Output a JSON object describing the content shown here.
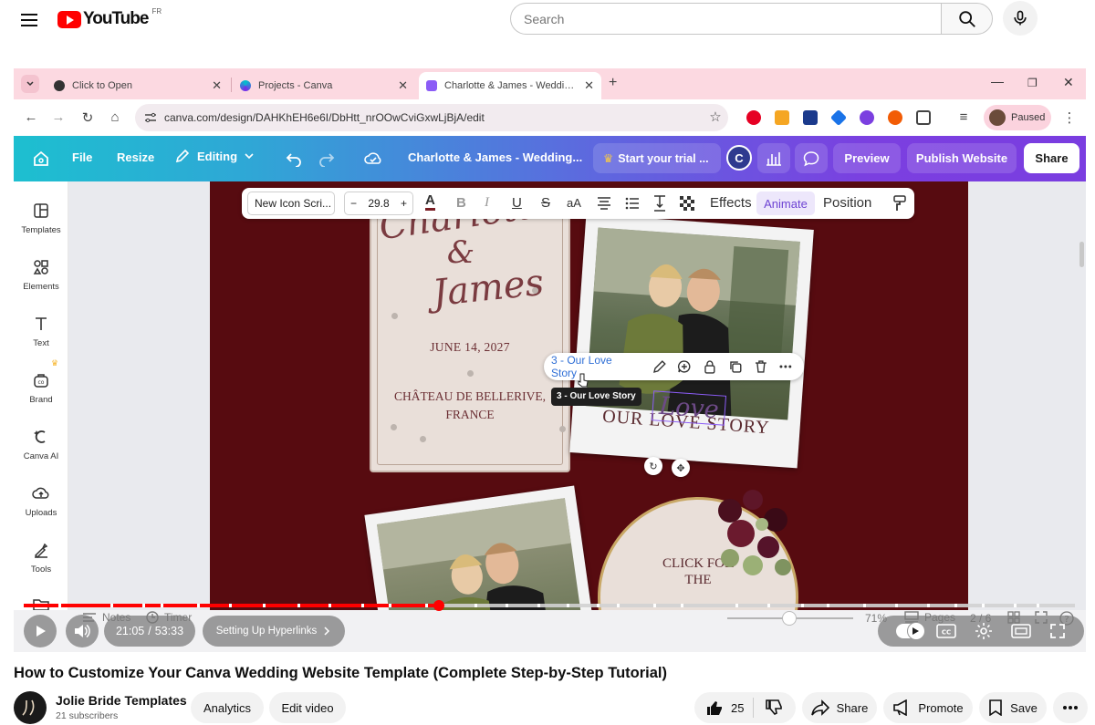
{
  "youtube": {
    "logo_text": "YouTube",
    "country": "FR",
    "search_placeholder": "Search"
  },
  "browser": {
    "tabs": [
      {
        "label": "Click to Open",
        "active": false
      },
      {
        "label": "Projects - Canva",
        "active": false
      },
      {
        "label": "Charlotte & James - Wedding W",
        "active": true
      }
    ],
    "url": "canva.com/design/DAHKhEH6e6I/DbHtt_nrOOwCviGxwLjBjA/edit",
    "profile_label": "Paused"
  },
  "canva": {
    "toolbar": {
      "file": "File",
      "resize": "Resize",
      "editing": "Editing",
      "doc_title": "Charlotte & James - Wedding...",
      "trial": "Start your trial ...",
      "avatar_initial": "C",
      "preview": "Preview",
      "publish": "Publish Website",
      "share": "Share"
    },
    "rail": [
      {
        "label": "Templates",
        "icon": "templates-icon"
      },
      {
        "label": "Elements",
        "icon": "elements-icon"
      },
      {
        "label": "Text",
        "icon": "text-icon"
      },
      {
        "label": "Brand",
        "icon": "brand-icon"
      },
      {
        "label": "Canva AI",
        "icon": "canva-ai-icon"
      },
      {
        "label": "Uploads",
        "icon": "uploads-icon"
      },
      {
        "label": "Tools",
        "icon": "tools-icon"
      }
    ],
    "format_bar": {
      "font": "New Icon Scri...",
      "size": "29.8",
      "case": "aA",
      "effects": "Effects",
      "animate": "Animate",
      "position": "Position"
    },
    "canvas": {
      "card_script": [
        "Charlotte",
        "&",
        "James"
      ],
      "card_date": "JUNE 14, 2027",
      "card_venue_line1": "CHÂTEAU DE BELLERIVE,",
      "card_venue_line2": "FRANCE",
      "photo_caption": "OUR LOVE STORY",
      "photo_caption_script": "Love",
      "circle_line1": "CLICK FOR",
      "circle_line2": "THE"
    },
    "link_popup": {
      "label": "3 - Our Love Story",
      "tooltip": "3 - Our Love Story"
    },
    "bottom": {
      "notes": "Notes",
      "timer": "Timer",
      "zoom": "71%",
      "pages": "Pages",
      "page_counter": "2 / 6"
    }
  },
  "player": {
    "current_time": "21:05",
    "duration": "53:33",
    "chapter": "Setting Up Hyperlinks",
    "progress_fraction": 0.395
  },
  "video_meta": {
    "title": "How to Customize Your Canva Wedding Website Template (Complete Step-by-Step Tutorial)",
    "channel": "Jolie Bride Templates",
    "subscribers": "21 subscribers",
    "analytics": "Analytics",
    "edit_video": "Edit video",
    "likes": "25",
    "share": "Share",
    "promote": "Promote",
    "save": "Save"
  },
  "colors": {
    "youtube_red": "#ff0000",
    "canvas_maroon": "#570b10",
    "link_blue": "#2f6fd6",
    "animate_purple": "#6d43d3"
  }
}
